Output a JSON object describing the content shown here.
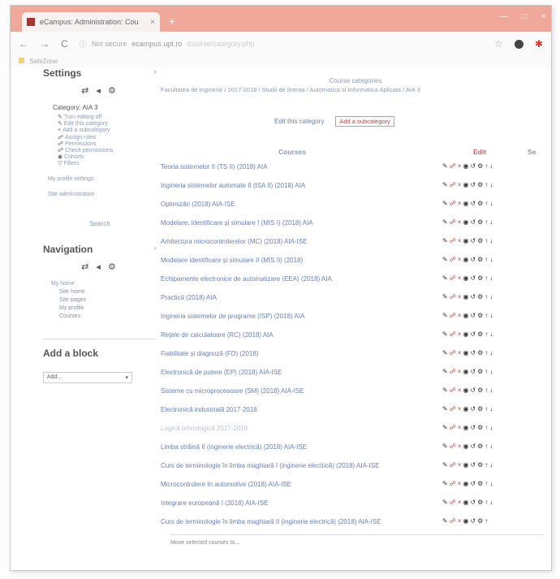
{
  "browser": {
    "tab_title": "eCampus: Administration: Cou",
    "tab_close": "×",
    "new_tab": "+",
    "win_buttons": [
      "—",
      "□",
      "×"
    ],
    "nav_back": "←",
    "nav_forward": "→",
    "nav_reload": "C",
    "security": "Not secure",
    "url_host": "ecampus.upt.ro",
    "url_path": "/course/category.php",
    "star": "☆",
    "bookmark": "SafeZone"
  },
  "settings": {
    "title": "Settings",
    "collapse": "‹",
    "icons": "⇄ ◂ ⚙",
    "category_label": "Category: AIA 3",
    "items": [
      {
        "icon": "✎",
        "label": "Turn editing off"
      },
      {
        "icon": "✎",
        "label": "Edit this category"
      },
      {
        "icon": "+",
        "label": "Add a subcategory"
      },
      {
        "icon": "☍",
        "label": "Assign roles"
      },
      {
        "icon": "☍",
        "label": "Permissions"
      },
      {
        "icon": "☍",
        "label": "Check permissions"
      },
      {
        "icon": "◉",
        "label": "Cohorts"
      },
      {
        "icon": "▽",
        "label": "Filters"
      }
    ],
    "profile_settings": "My profile settings",
    "site_admin": "Site administration",
    "search": "Search"
  },
  "navigation": {
    "title": "Navigation",
    "collapse": "‹",
    "icons": "⇄ ◂ ⚙",
    "items": [
      {
        "label": "My home",
        "sub": false
      },
      {
        "label": "Site home",
        "sub": true
      },
      {
        "label": "Site pages",
        "sub": true
      },
      {
        "label": "My profile",
        "sub": true
      },
      {
        "label": "Courses",
        "sub": true
      }
    ]
  },
  "add_block": {
    "title": "Add a block",
    "select_value": "Add...",
    "select_arrow": "▾"
  },
  "main": {
    "crumb_title": "Course categories",
    "breadcrumb": "Facultatea de Inginerie / 2017-2018 / Studii de licenta / Automatica si Informatica Aplicata / AIA 3",
    "edit_category": "Edit this category",
    "add_subcategory": "Add a subcategory",
    "col_courses": "Courses",
    "col_edit": "Edit",
    "col_select": "Se"
  },
  "courses": [
    {
      "name": "Teoria sistemelor II (TS II) (2018) AIA",
      "dim": false
    },
    {
      "name": "Ingineria sistemelor automate II (ISA II) (2018) AIA",
      "dim": false
    },
    {
      "name": "Optimizări (2018) AIA-ISE",
      "dim": false
    },
    {
      "name": "Modelare, identificare și simulare I (MIS I) (2018) AIA",
      "dim": false
    },
    {
      "name": "Arhitectura microcontrolerelor (MC) (2018) AIA-ISE",
      "dim": false
    },
    {
      "name": "Modelare identificare și simulare II (MIS II) (2018)",
      "dim": false
    },
    {
      "name": "Echipamente electronice de automatizare (EEA) (2018) AIA",
      "dim": false
    },
    {
      "name": "Practică (2018) AIA",
      "dim": false
    },
    {
      "name": "Ingineria sistemelor de programe (ISP) (2018) AIA",
      "dim": false
    },
    {
      "name": "Rețele de calculatoare (RC) (2018) AIA",
      "dim": false
    },
    {
      "name": "Fiabilitate și diagnoză (FD) (2018)",
      "dim": false
    },
    {
      "name": "Electronică de putere (EP) (2018) AIA-ISE",
      "dim": false
    },
    {
      "name": "Sisteme cu microprocesoare (SM) (2018) AIA-ISE",
      "dim": false
    },
    {
      "name": "Electronică industrială 2017-2018",
      "dim": false
    },
    {
      "name": "Logică tehnologică 2017-2018",
      "dim": true
    },
    {
      "name": "Limba străină II (inginerie electrică) (2018) AIA-ISE",
      "dim": false
    },
    {
      "name": "Curs de terminologie în limba maghiară I (inginerie electrică) (2018) AIA-ISE",
      "dim": false
    },
    {
      "name": "Microcontrolere în automotive (2018) AIA-ISE",
      "dim": false
    },
    {
      "name": "Integrare europeană I (2018) AIA-ISE",
      "dim": false
    },
    {
      "name": "Curs de terminologie în limba maghiară II (inginerie electrică) (2018) AIA-ISE",
      "dim": false
    }
  ],
  "actions": {
    "edit": "✎",
    "roles": "☍",
    "delete": "×",
    "hide": "◉",
    "backup": "↺",
    "settings": "⚙",
    "up": "↑",
    "down": "↓"
  },
  "move_selected": "Move selected courses to..."
}
